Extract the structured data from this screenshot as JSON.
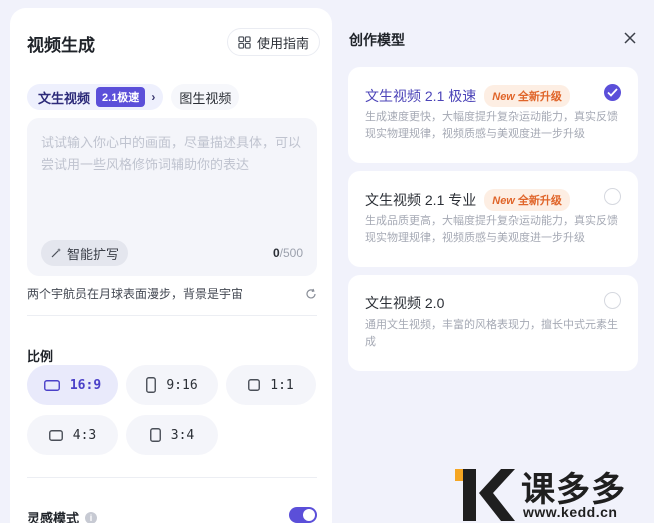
{
  "left_panel": {
    "title": "视频生成",
    "guide_button": "使用指南",
    "tabs": {
      "text_to_video": "文生视频",
      "speed_badge": "2.1极速",
      "image_to_video": "图生视频"
    },
    "prompt": {
      "placeholder": "试试输入你心中的画面，尽量描述具体，可以尝试用一些风格修饰词辅助你的表达",
      "expand_button": "智能扩写",
      "count_current": "0",
      "count_max": "/500"
    },
    "example_prompt": "两个宇航员在月球表面漫步，背景是宇宙",
    "ratio": {
      "label": "比例",
      "options": [
        "16:9",
        "9:16",
        "1:1",
        "4:3",
        "3:4"
      ],
      "selected": "16:9"
    },
    "inspiration_mode": {
      "label": "灵感模式",
      "enabled": true
    }
  },
  "right_panel": {
    "title": "创作模型",
    "models": [
      {
        "name": "文生视频 2.1 极速",
        "badge_new": "New",
        "badge_text": "全新升级",
        "description": "生成速度更快，大幅度提升复杂运动能力，真实反馈现实物理规律，视频质感与美观度进一步升级",
        "selected": true
      },
      {
        "name": "文生视频 2.1 专业",
        "badge_new": "New",
        "badge_text": "全新升级",
        "description": "生成品质更高，大幅度提升复杂运动能力，真实反馈现实物理规律，视频质感与美观度进一步升级",
        "selected": false
      },
      {
        "name": "文生视频 2.0",
        "description": "通用文生视频，丰富的风格表现力，擅长中式元素生成",
        "selected": false
      }
    ]
  },
  "watermark": {
    "brand": "课多多",
    "url": "www.kedd.cn"
  },
  "colors": {
    "accent": "#5b4fd9",
    "badge_orange": "#e0652a",
    "background": "#f1f2fb"
  }
}
